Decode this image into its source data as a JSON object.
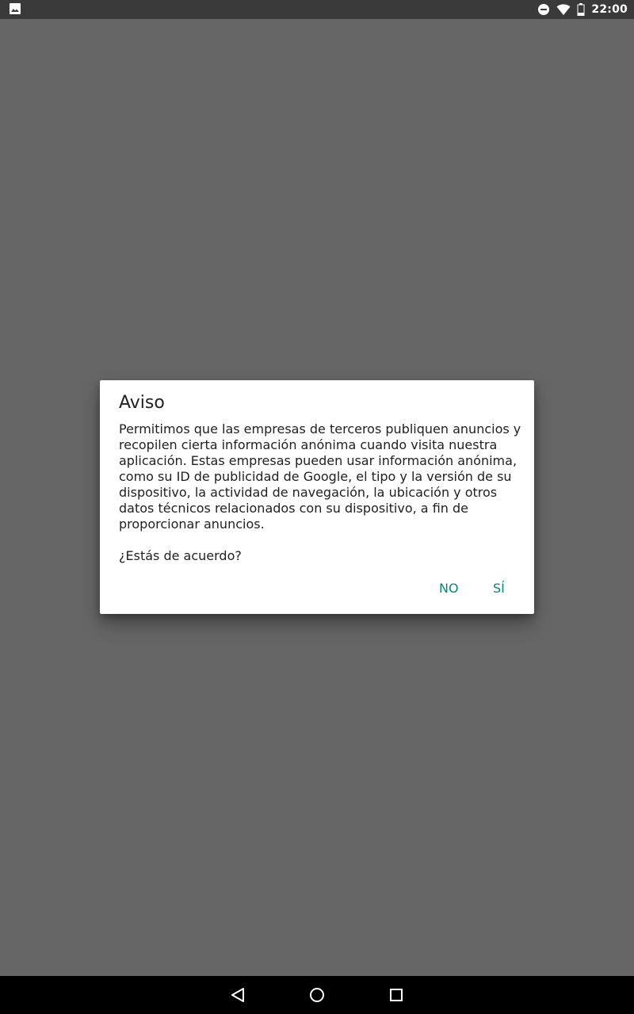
{
  "status_bar": {
    "time": "22:00",
    "icons": [
      "image-notification-icon",
      "do-not-disturb-icon",
      "wifi-icon",
      "battery-icon"
    ]
  },
  "dialog": {
    "title": "Aviso",
    "body": "Permitimos que las empresas de terceros publiquen anuncios y recopilen cierta información anónima cuando visita nuestra aplicación. Estas empresas pueden usar información anónima, como su ID de publicidad de Google, el tipo y la versión de su dispositivo, la actividad de navegación, la ubicación y otros datos técnicos relacionados con su dispositivo, a fin de proporcionar anuncios.",
    "question": "¿Estás de acuerdo?",
    "buttons": {
      "no": "NO",
      "yes": "SÍ"
    }
  },
  "navigation_bar": {
    "icons": [
      "back-icon",
      "home-icon",
      "recent-apps-icon"
    ]
  },
  "colors": {
    "accent": "#00897b",
    "scrim": "#666666",
    "status_bar": "#3a3a3a",
    "nav_bar": "#000000"
  }
}
